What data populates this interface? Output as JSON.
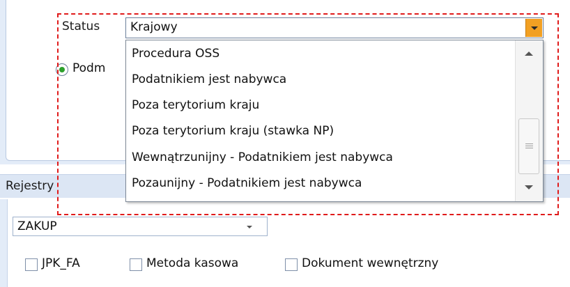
{
  "status": {
    "label": "Status",
    "value": "Krajowy"
  },
  "radio": {
    "label": "Podm",
    "selected": true
  },
  "dropdown": {
    "items": [
      "Procedura OSS",
      "Podatnikiem jest nabywca",
      "Poza terytorium kraju",
      "Poza terytorium kraju (stawka NP)",
      "Wewnątrzunijny - Podatnikiem jest nabywca",
      "Pozaunijny - Podatnikiem jest nabywca"
    ]
  },
  "rejestry": {
    "header": "Rejestry",
    "combo_value": "ZAKUP",
    "checkboxes": [
      {
        "label": "JPK_FA",
        "checked": false
      },
      {
        "label": "Metoda kasowa",
        "checked": false
      },
      {
        "label": "Dokument wewnętrzny",
        "checked": false
      }
    ]
  },
  "colors": {
    "combo_button": "#f2a023",
    "highlight": "#e01b1b",
    "radio_dot": "#2ca02c"
  }
}
